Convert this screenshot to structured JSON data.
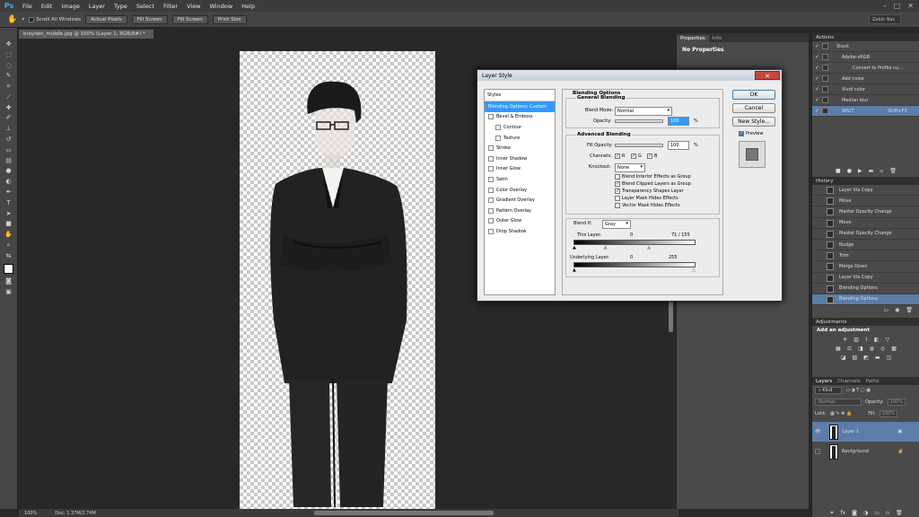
{
  "app": {
    "logo": "Ps",
    "menu": [
      "File",
      "Edit",
      "Image",
      "Layer",
      "Type",
      "Select",
      "Filter",
      "View",
      "Window",
      "Help"
    ],
    "window_controls": [
      "–",
      "□",
      "✕"
    ]
  },
  "options_bar": {
    "scroll_all": "Scroll All Windows",
    "buttons": [
      "Actual Pixels",
      "Fill Screen",
      "Fill Screen",
      "Print Size"
    ],
    "workspace": "Zablo Nac"
  },
  "document": {
    "tab_title": "brayden_middle.jpg @ 100% (Layer 1, RGB/8#) *",
    "zoom": "100%",
    "doc_info": "Doc: 1.37M/2.74M"
  },
  "properties_panel": {
    "tabs": [
      "Properties",
      "Info"
    ],
    "title": "No Properties"
  },
  "actions_panel": {
    "tab": "Actions",
    "items": [
      {
        "label": "Stock",
        "indent": 1
      },
      {
        "label": "Adobe-sRGB",
        "indent": 2
      },
      {
        "label": "Convert to Profile cu...",
        "indent": 3
      },
      {
        "label": "Add noise",
        "indent": 2
      },
      {
        "label": "Vivid color",
        "indent": 2
      },
      {
        "label": "Median blur",
        "indent": 2
      },
      {
        "label": "SPLIT",
        "indent": 2,
        "shortcut": "Shift+F3",
        "selected": true
      }
    ]
  },
  "history_panel": {
    "tab": "History",
    "items": [
      "Layer Via Copy",
      "Move",
      "Master Opacity Change",
      "Move",
      "Master Opacity Change",
      "Nudge",
      "Trim",
      "Merge Down",
      "Layer Via Copy",
      "Blending Options",
      "Blending Options"
    ],
    "selected_index": 10
  },
  "adjustments_panel": {
    "tab": "Adjustments",
    "title": "Add an adjustment"
  },
  "layers_panel": {
    "tabs": [
      "Layers",
      "Channels",
      "Paths"
    ],
    "kind": "Kind",
    "blend_mode": "Normal",
    "opacity_label": "Opacity:",
    "opacity": "100%",
    "lock_label": "Lock:",
    "fill_label": "Fill:",
    "fill": "100%",
    "layers": [
      {
        "name": "Layer 1",
        "selected": true
      },
      {
        "name": "Background",
        "selected": false
      }
    ]
  },
  "layer_style_dialog": {
    "title": "Layer Style",
    "close": "✕",
    "styles_header": "Styles",
    "styles": [
      {
        "label": "Blending Options: Custom",
        "selected": true,
        "checkbox": false
      },
      {
        "label": "Bevel & Emboss",
        "checkbox": true
      },
      {
        "label": "Contour",
        "checkbox": true,
        "sub": true
      },
      {
        "label": "Texture",
        "checkbox": true,
        "sub": true
      },
      {
        "label": "Stroke",
        "checkbox": true
      },
      {
        "label": "Inner Shadow",
        "checkbox": true
      },
      {
        "label": "Inner Glow",
        "checkbox": true
      },
      {
        "label": "Satin",
        "checkbox": true
      },
      {
        "label": "Color Overlay",
        "checkbox": true
      },
      {
        "label": "Gradient Overlay",
        "checkbox": true
      },
      {
        "label": "Pattern Overlay",
        "checkbox": true
      },
      {
        "label": "Outer Glow",
        "checkbox": true
      },
      {
        "label": "Drop Shadow",
        "checkbox": true
      }
    ],
    "blending_options": "Blending Options",
    "general_blending": "General Blending",
    "blend_mode_label": "Blend Mode:",
    "blend_mode": "Normal",
    "opacity_label": "Opacity:",
    "opacity": "100",
    "percent": "%",
    "advanced_blending": "Advanced Blending",
    "fill_opacity_label": "Fill Opacity:",
    "fill_opacity": "100",
    "channels_label": "Channels:",
    "channels": [
      "R",
      "G",
      "B"
    ],
    "knockout_label": "Knockout:",
    "knockout": "None",
    "checkboxes": [
      {
        "label": "Blend Interior Effects as Group",
        "checked": false
      },
      {
        "label": "Blend Clipped Layers as Group",
        "checked": true
      },
      {
        "label": "Transparency Shapes Layer",
        "checked": true
      },
      {
        "label": "Layer Mask Hides Effects",
        "checked": false
      },
      {
        "label": "Vector Mask Hides Effects",
        "checked": false
      }
    ],
    "blend_if_label": "Blend If:",
    "blend_if": "Gray",
    "this_layer_label": "This Layer:",
    "this_layer_low": "0",
    "this_layer_high": "71  /  155",
    "underlying_label": "Underlying Layer:",
    "underlying_low": "0",
    "underlying_high": "255",
    "buttons": {
      "ok": "OK",
      "cancel": "Cancel",
      "new_style": "New Style...",
      "preview": "Preview"
    }
  }
}
